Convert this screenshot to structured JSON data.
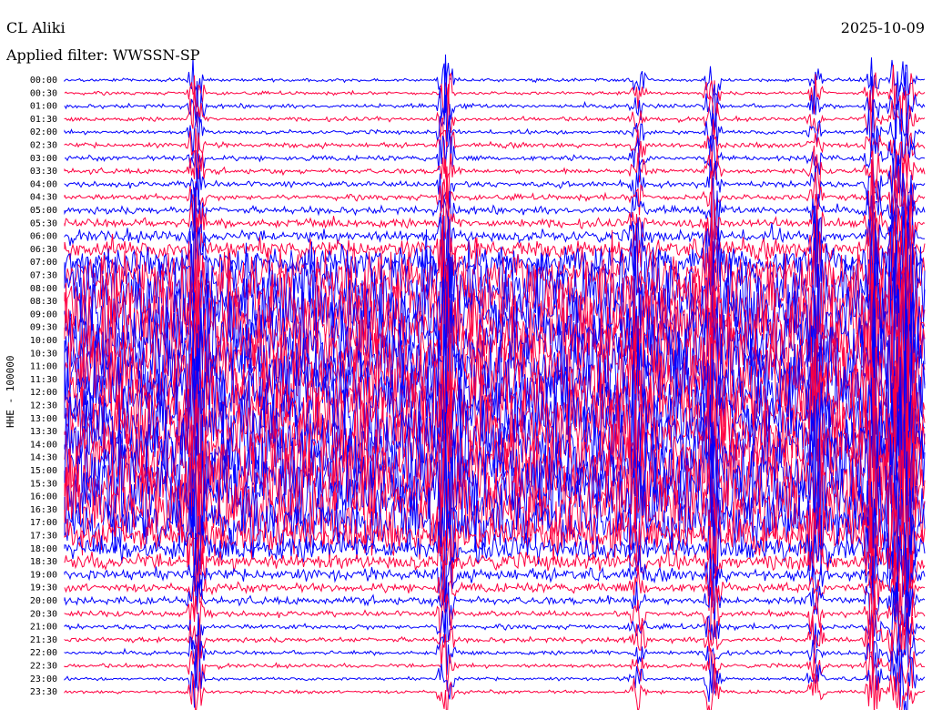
{
  "header": {
    "station": "CL Aliki",
    "date": "2025-10-09",
    "filter": "Applied filter: WWSSN-SP"
  },
  "colors": {
    "even_hour": "#0000ff",
    "half_hour": "#ff0040",
    "text": "#000000",
    "background": "#ffffff"
  },
  "chart_data": {
    "type": "line",
    "ylabel": "HHE - 100000",
    "grid": false,
    "legend": "none",
    "time_range_minutes": [
      0,
      30
    ],
    "rows": [
      {
        "label": "00:00",
        "color": "#0000ff",
        "level": 0.03
      },
      {
        "label": "00:30",
        "color": "#ff0040",
        "level": 0.03
      },
      {
        "label": "01:00",
        "color": "#0000ff",
        "level": 0.04
      },
      {
        "label": "01:30",
        "color": "#ff0040",
        "level": 0.04
      },
      {
        "label": "02:00",
        "color": "#0000ff",
        "level": 0.04
      },
      {
        "label": "02:30",
        "color": "#ff0040",
        "level": 0.05
      },
      {
        "label": "03:00",
        "color": "#0000ff",
        "level": 0.05
      },
      {
        "label": "03:30",
        "color": "#ff0040",
        "level": 0.05
      },
      {
        "label": "04:00",
        "color": "#0000ff",
        "level": 0.06
      },
      {
        "label": "04:30",
        "color": "#ff0040",
        "level": 0.06
      },
      {
        "label": "05:00",
        "color": "#0000ff",
        "level": 0.08
      },
      {
        "label": "05:30",
        "color": "#ff0040",
        "level": 0.1
      },
      {
        "label": "06:00",
        "color": "#0000ff",
        "level": 0.14
      },
      {
        "label": "06:30",
        "color": "#ff0040",
        "level": 0.22
      },
      {
        "label": "07:00",
        "color": "#0000ff",
        "level": 0.35
      },
      {
        "label": "07:30",
        "color": "#ff0040",
        "level": 0.6
      },
      {
        "label": "08:00",
        "color": "#0000ff",
        "level": 1.0
      },
      {
        "label": "08:30",
        "color": "#ff0040",
        "level": 1.0
      },
      {
        "label": "09:00",
        "color": "#0000ff",
        "level": 1.0
      },
      {
        "label": "09:30",
        "color": "#ff0040",
        "level": 1.0
      },
      {
        "label": "10:00",
        "color": "#0000ff",
        "level": 1.0
      },
      {
        "label": "10:30",
        "color": "#ff0040",
        "level": 1.0
      },
      {
        "label": "11:00",
        "color": "#0000ff",
        "level": 1.0
      },
      {
        "label": "11:30",
        "color": "#ff0040",
        "level": 1.0
      },
      {
        "label": "12:00",
        "color": "#0000ff",
        "level": 1.0
      },
      {
        "label": "12:30",
        "color": "#ff0040",
        "level": 1.0
      },
      {
        "label": "13:00",
        "color": "#0000ff",
        "level": 1.0
      },
      {
        "label": "13:30",
        "color": "#ff0040",
        "level": 1.0
      },
      {
        "label": "14:00",
        "color": "#0000ff",
        "level": 1.0
      },
      {
        "label": "14:30",
        "color": "#ff0040",
        "level": 1.0
      },
      {
        "label": "15:00",
        "color": "#0000ff",
        "level": 1.0
      },
      {
        "label": "15:30",
        "color": "#ff0040",
        "level": 1.0
      },
      {
        "label": "16:00",
        "color": "#0000ff",
        "level": 1.0
      },
      {
        "label": "16:30",
        "color": "#ff0040",
        "level": 1.0
      },
      {
        "label": "17:00",
        "color": "#0000ff",
        "level": 0.7
      },
      {
        "label": "17:30",
        "color": "#ff0040",
        "level": 0.45
      },
      {
        "label": "18:00",
        "color": "#0000ff",
        "level": 0.3
      },
      {
        "label": "18:30",
        "color": "#ff0040",
        "level": 0.2
      },
      {
        "label": "19:00",
        "color": "#0000ff",
        "level": 0.14
      },
      {
        "label": "19:30",
        "color": "#ff0040",
        "level": 0.1
      },
      {
        "label": "20:00",
        "color": "#0000ff",
        "level": 0.08
      },
      {
        "label": "20:30",
        "color": "#ff0040",
        "level": 0.06
      },
      {
        "label": "21:00",
        "color": "#0000ff",
        "level": 0.05
      },
      {
        "label": "21:30",
        "color": "#ff0040",
        "level": 0.05
      },
      {
        "label": "22:00",
        "color": "#0000ff",
        "level": 0.04
      },
      {
        "label": "22:30",
        "color": "#ff0040",
        "level": 0.04
      },
      {
        "label": "23:00",
        "color": "#0000ff",
        "level": 0.03
      },
      {
        "label": "23:30",
        "color": "#ff0040",
        "level": 0.03
      }
    ],
    "events": [
      {
        "minute": 4.6,
        "color": "#ff0040",
        "strength": 1.0
      },
      {
        "minute": 13.3,
        "color": "#0000ff",
        "strength": 1.0
      },
      {
        "minute": 22.6,
        "color": "#ff0040",
        "strength": 0.8
      },
      {
        "minute": 20.0,
        "color": "#ff0040",
        "strength": 0.5
      },
      {
        "minute": 26.2,
        "color": "#ff0040",
        "strength": 0.6
      },
      {
        "minute": 28.2,
        "color": "#0000ff",
        "strength": 0.9
      },
      {
        "minute": 29.0,
        "color": "#ff0040",
        "strength": 1.0
      },
      {
        "minute": 29.4,
        "color": "#ff0040",
        "strength": 1.0
      }
    ]
  }
}
